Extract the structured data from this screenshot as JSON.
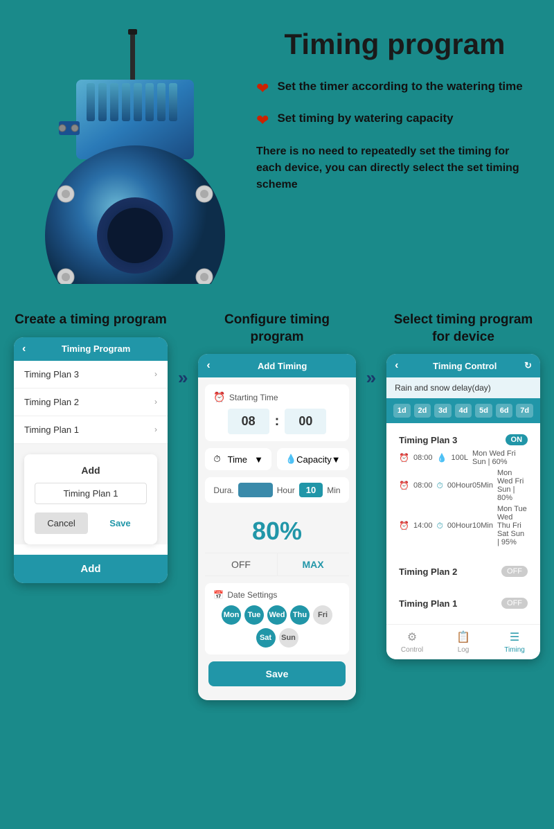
{
  "page": {
    "title": "Timing program",
    "background_color": "#1a8a8a"
  },
  "header": {
    "bullet1": "Set the timer according to the watering time",
    "bullet2": "Set timing by watering capacity",
    "description": "There is no need to repeatedly set the timing for each device, you can directly select the set timing scheme"
  },
  "steps": [
    {
      "title": "Create a timing program",
      "phone_header": "Timing Program",
      "list_items": [
        "Timing Plan 3",
        "Timing Plan 2",
        "Timing Plan 1"
      ],
      "add_dialog_title": "Add",
      "add_dialog_input": "Timing Plan 1",
      "cancel_label": "Cancel",
      "save_label": "Save",
      "add_btn": "Add"
    },
    {
      "title": "Configure timing program",
      "phone_header": "Add Timing",
      "starting_time_label": "Starting Time",
      "hour": "08",
      "minute": "00",
      "mode1": "Time",
      "mode2": "Capacity",
      "dura_label": "Dura.",
      "hour_label": "Hour",
      "val1": "10",
      "min_label": "Min",
      "percent": "80%",
      "off_label": "OFF",
      "max_label": "MAX",
      "date_settings_label": "Date Settings",
      "days": [
        {
          "label": "Mon",
          "active": true
        },
        {
          "label": "Tue",
          "active": true
        },
        {
          "label": "Wed",
          "active": true
        },
        {
          "label": "Thu",
          "active": true
        },
        {
          "label": "Fri",
          "active": false
        },
        {
          "label": "Sat",
          "active": true
        },
        {
          "label": "Sun",
          "active": false
        }
      ],
      "save_btn": "Save"
    },
    {
      "title": "Select timing program for device",
      "phone_header": "Timing Control",
      "rain_delay": "Rain and snow delay(day)",
      "delay_days": [
        "1d",
        "2d",
        "3d",
        "4d",
        "5d",
        "6d",
        "7d"
      ],
      "plans": [
        {
          "name": "Timing Plan 3",
          "toggle": "ON",
          "entries": [
            {
              "time": "08:00",
              "detail": "100L",
              "days": "Mon Wed Fri Sun | 60%"
            },
            {
              "time": "08:00",
              "detail": "00Hour05Min",
              "days": "Mon Wed Fri Sun | 80%"
            },
            {
              "time": "14:00",
              "detail": "00Hour10Min",
              "days": "Mon Tue Wed Thu Fri Sat Sun | 95%"
            }
          ]
        },
        {
          "name": "Timing Plan 2",
          "toggle": "OFF",
          "entries": []
        },
        {
          "name": "Timing Plan 1",
          "toggle": "OFF",
          "entries": []
        }
      ],
      "nav_items": [
        "Control",
        "Log",
        "Timing"
      ]
    }
  ],
  "dura_hou_text": "Dura Hou"
}
